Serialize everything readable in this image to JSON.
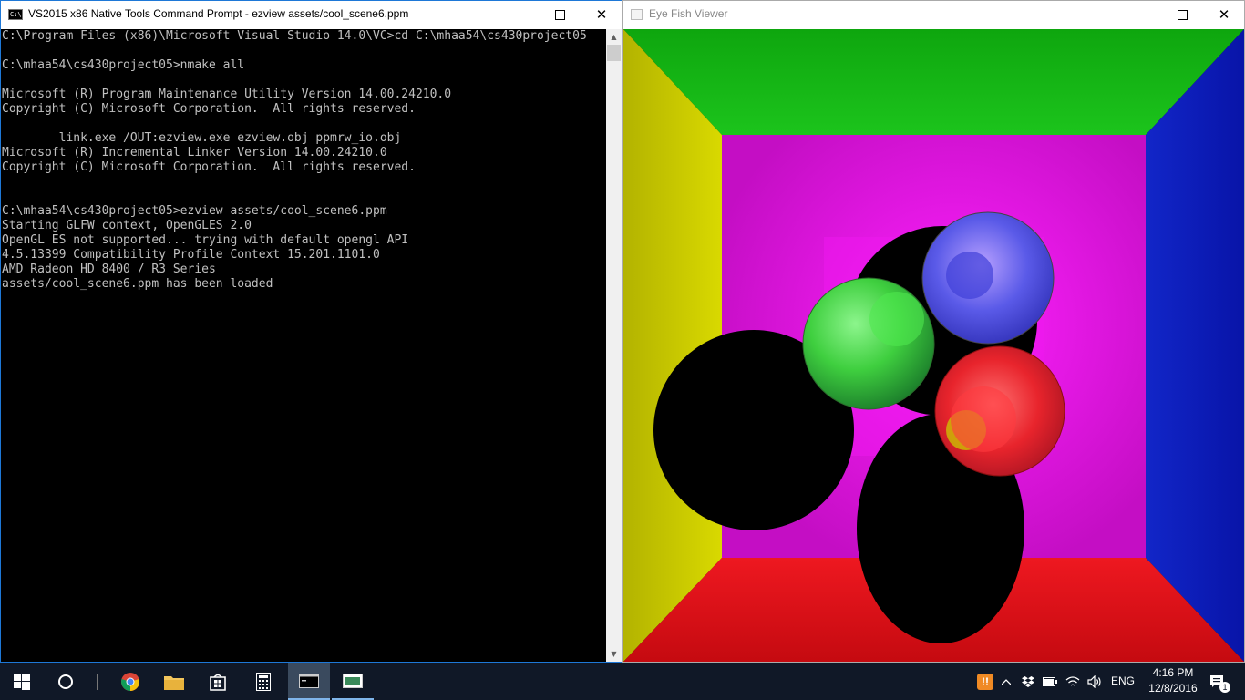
{
  "cmd_window": {
    "title": "VS2015 x86 Native Tools Command Prompt - ezview  assets/cool_scene6.ppm",
    "icon_text": "C:\\",
    "console_lines": [
      "C:\\Program Files (x86)\\Microsoft Visual Studio 14.0\\VC>cd C:\\mhaa54\\cs430project05",
      "",
      "C:\\mhaa54\\cs430project05>nmake all",
      "",
      "Microsoft (R) Program Maintenance Utility Version 14.00.24210.0",
      "Copyright (C) Microsoft Corporation.  All rights reserved.",
      "",
      "        link.exe /OUT:ezview.exe ezview.obj ppmrw_io.obj",
      "Microsoft (R) Incremental Linker Version 14.00.24210.0",
      "Copyright (C) Microsoft Corporation.  All rights reserved.",
      "",
      "",
      "C:\\mhaa54\\cs430project05>ezview assets/cool_scene6.ppm",
      "Starting GLFW context, OpenGLES 2.0",
      "OpenGL ES not supported... trying with default opengl API",
      "4.5.13399 Compatibility Profile Context 15.201.1101.0",
      "AMD Radeon HD 8400 / R3 Series",
      "assets/cool_scene6.ppm has been loaded"
    ],
    "scroll_up": "▲",
    "scroll_down": "▼"
  },
  "viewer_window": {
    "title": "Eye Fish Viewer",
    "scene": {
      "wall_colors": {
        "top": "#17b317",
        "left": "#c9c900",
        "right": "#0b1fb8",
        "bottom": "#d60e16",
        "back": "#ee10ee"
      },
      "sphere_colors": {
        "green": "#3fcf3f",
        "blue": "#5a5ae8",
        "red": "#e8242c"
      }
    }
  },
  "caption_buttons": {
    "minimize": "—",
    "maximize": "☐",
    "close": "✕"
  },
  "taskbar": {
    "start_icon": "windows-logo",
    "search_icon": "cortana-circle",
    "apps": [
      {
        "name": "chrome",
        "icon": "chrome-icon"
      },
      {
        "name": "file-explorer",
        "icon": "folder-icon"
      },
      {
        "name": "store",
        "icon": "store-icon"
      },
      {
        "name": "calculator",
        "icon": "calculator-icon"
      },
      {
        "name": "command-prompt",
        "icon": "cmd-icon"
      },
      {
        "name": "eye-fish-viewer",
        "icon": "app-window-icon"
      }
    ],
    "tray": {
      "notification_badge": "!!",
      "language": "ENG",
      "time": "4:16 PM",
      "date": "12/8/2016",
      "action_center_count": "1"
    }
  }
}
